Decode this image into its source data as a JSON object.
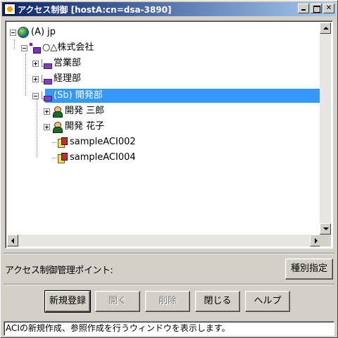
{
  "window": {
    "title": "アクセス制御 [hostA:cn=dsa-3890]"
  },
  "tree": {
    "root": {
      "label": "(A) jp"
    },
    "org": {
      "label": "○△株式会社"
    },
    "units": [
      {
        "label": "営業部",
        "expanded": false
      },
      {
        "label": "経理部",
        "expanded": false
      },
      {
        "label": "(Sb) 開発部",
        "expanded": true,
        "selected": true
      }
    ],
    "children": [
      {
        "label": "開発 三郎",
        "type": "person"
      },
      {
        "label": "開発 花子",
        "type": "person"
      },
      {
        "label": "sampleACI002",
        "type": "aci"
      },
      {
        "label": "sampleACI004",
        "type": "aci"
      }
    ]
  },
  "aci_point_label": "アクセス制御管理ポイント:",
  "buttons": {
    "type_spec": "種別指定",
    "register": "新規登録",
    "open": "開く",
    "delete": "削除",
    "close": "閉じる",
    "help": "ヘルプ"
  },
  "status": "ACIの新規作成、参照作成を行うウィンドウを表示します。",
  "colors": {
    "selection": "#3399ff",
    "title_bar": "#0a246a",
    "face": "#d4d0c8"
  }
}
